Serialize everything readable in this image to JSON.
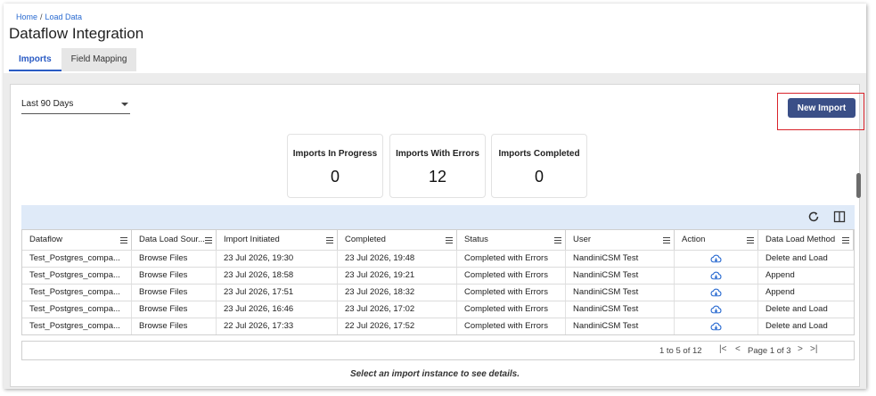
{
  "breadcrumb": {
    "home": "Home",
    "separator": "/",
    "current": "Load Data"
  },
  "page": {
    "title": "Dataflow Integration"
  },
  "tabs": [
    {
      "label": "Imports",
      "active": true
    },
    {
      "label": "Field Mapping",
      "active": false
    }
  ],
  "filters": {
    "range_value": "Last 90 Days"
  },
  "actions": {
    "new_import_label": "New Import"
  },
  "stats": [
    {
      "label": "Imports In Progress",
      "value": "0"
    },
    {
      "label": "Imports With Errors",
      "value": "12"
    },
    {
      "label": "Imports Completed",
      "value": "0"
    }
  ],
  "grid": {
    "columns": [
      "Dataflow",
      "Data Load Sour...",
      "Import Initiated",
      "Completed",
      "Status",
      "User",
      "Action",
      "Data Load Method"
    ],
    "rows": [
      [
        "Test_Postgres_compa...",
        "Browse Files",
        "23 Jul 2026, 19:30",
        "23 Jul 2026, 19:48",
        "Completed with Errors",
        "NandiniCSM Test",
        "download-icon",
        "Delete and Load"
      ],
      [
        "Test_Postgres_compa...",
        "Browse Files",
        "23 Jul 2026, 18:58",
        "23 Jul 2026, 19:21",
        "Completed with Errors",
        "NandiniCSM Test",
        "download-icon",
        "Append"
      ],
      [
        "Test_Postgres_compa...",
        "Browse Files",
        "23 Jul 2026, 17:51",
        "23 Jul 2026, 18:32",
        "Completed with Errors",
        "NandiniCSM Test",
        "download-icon",
        "Append"
      ],
      [
        "Test_Postgres_compa...",
        "Browse Files",
        "23 Jul 2026, 16:46",
        "23 Jul 2026, 17:02",
        "Completed with Errors",
        "NandiniCSM Test",
        "download-icon",
        "Delete and Load"
      ],
      [
        "Test_Postgres_compa...",
        "Browse Files",
        "22 Jul 2026, 17:33",
        "22 Jul 2026, 17:52",
        "Completed with Errors",
        "NandiniCSM Test",
        "download-icon",
        "Delete and Load"
      ]
    ]
  },
  "pager": {
    "summary": "1 to 5 of 12",
    "first": "|<",
    "prev": "<",
    "page_text": "Page 1 of 3",
    "next": ">",
    "last": ">|"
  },
  "hint": "Select an import instance to see details.",
  "colors": {
    "accent": "#2a5bc4",
    "button": "#3a4f87",
    "highlight": "#d9232b",
    "toolbar": "#dfeaf8"
  },
  "icons": {
    "refresh": "refresh-icon",
    "columns": "columns-icon",
    "download": "download-icon",
    "column_menu": "menu-icon"
  }
}
